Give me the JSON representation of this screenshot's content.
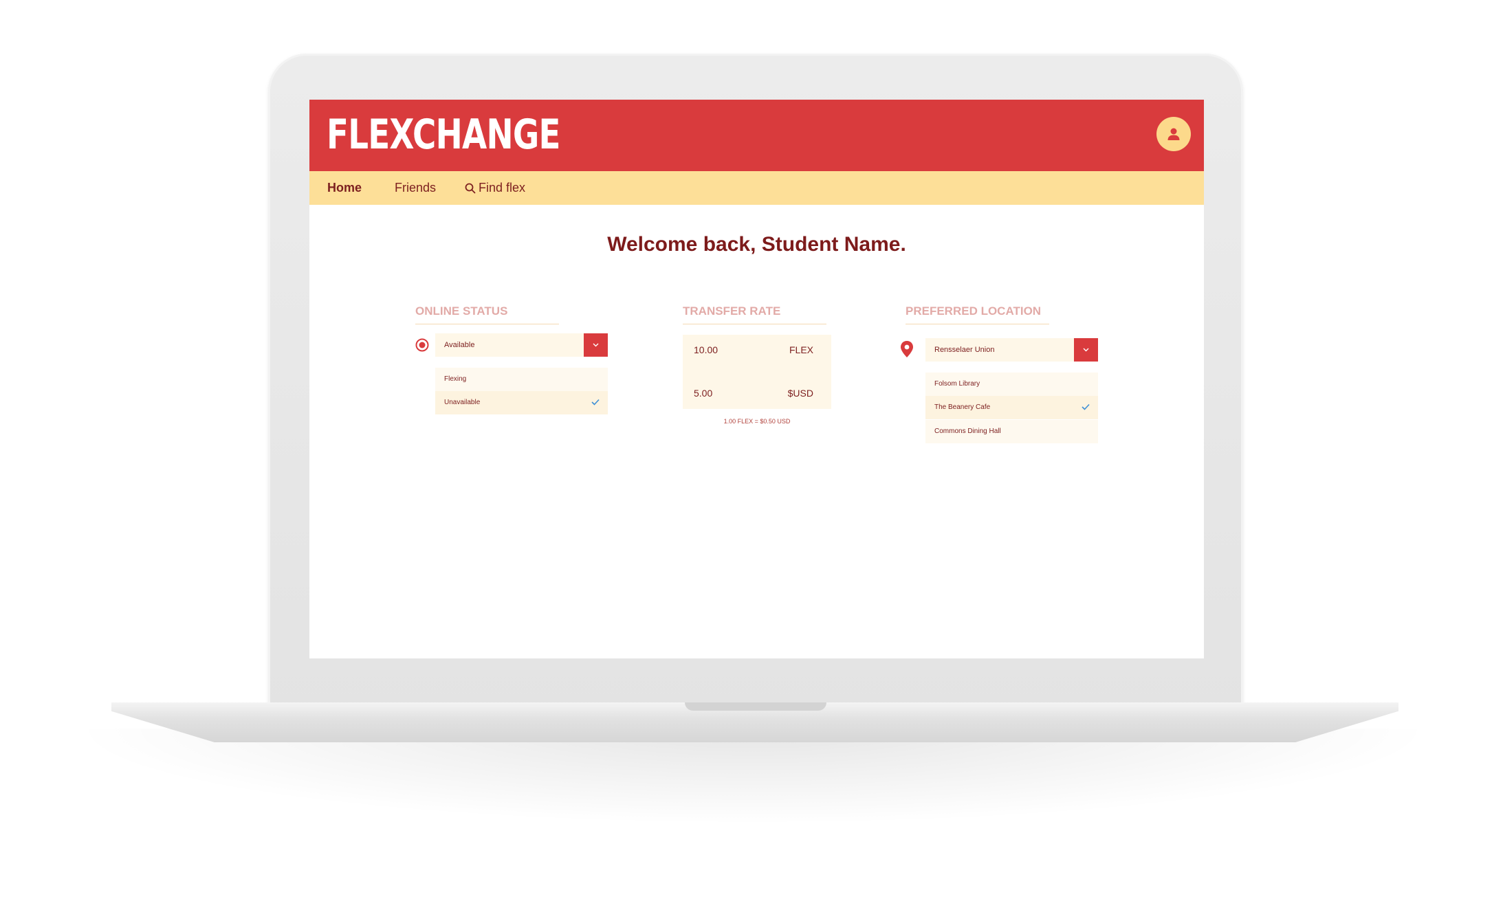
{
  "app": {
    "logo": "FLEXCHANGE",
    "accent": "#d93b3d",
    "nav_bg": "#fddf98",
    "avatar_icon": "user-icon"
  },
  "nav": {
    "home": "Home",
    "friends": "Friends",
    "find": "Find flex",
    "find_icon": "search-icon"
  },
  "main": {
    "welcome": "Welcome back, Student Name."
  },
  "online_status": {
    "title": "ONLINE STATUS",
    "selected": "Available",
    "options": [
      {
        "label": "Flexing",
        "checked": false
      },
      {
        "label": "Unavailable",
        "checked": true
      }
    ]
  },
  "transfer_rate": {
    "title": "TRANSFER RATE",
    "flex_value": "10.00",
    "flex_unit": "FLEX",
    "usd_value": "5.00",
    "usd_unit": "$USD",
    "note": "1.00 FLEX = $0.50 USD"
  },
  "preferred_location": {
    "title": "PREFERRED LOCATION",
    "selected": "Rensselaer Union",
    "options": [
      {
        "label": "Folsom Library",
        "checked": false
      },
      {
        "label": "The Beanery Cafe",
        "checked": true
      },
      {
        "label": "Commons Dining Hall",
        "checked": false
      }
    ]
  }
}
